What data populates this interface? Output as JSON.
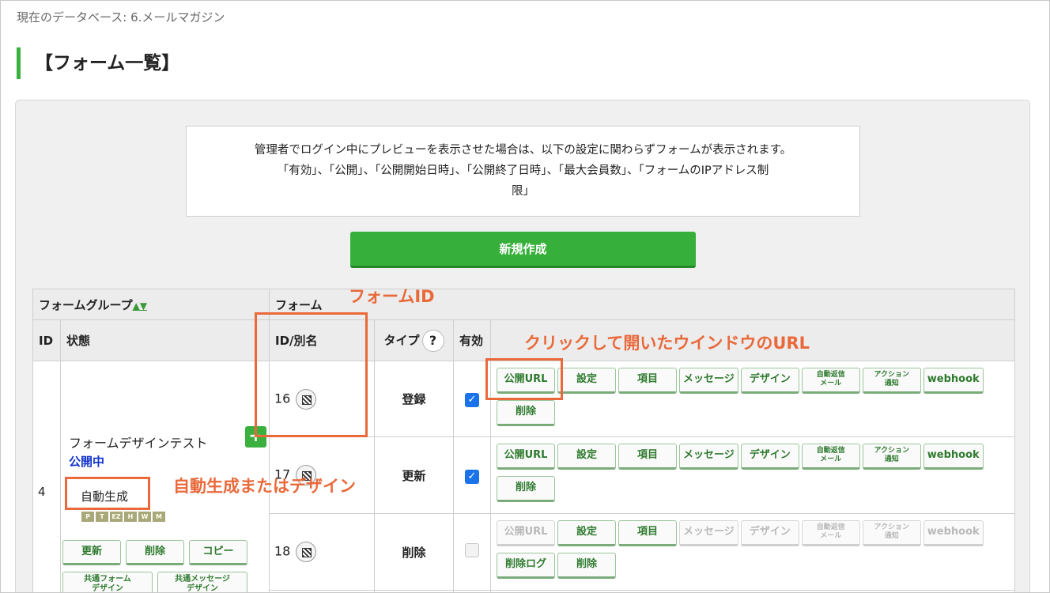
{
  "breadcrumb": "現在のデータベース: 6.メールマガジン",
  "page_title": "【フォーム一覧】",
  "notice": {
    "line1": "管理者でログイン中にプレビューを表示させた場合は、以下の設定に関わらずフォームが表示されます。",
    "line2": "「有効」、「公開」、「公開開始日時」、「公開終了日時」、「最大会員数」、「フォームのIPアドレス制",
    "line3": "限」"
  },
  "create_button": "新規作成",
  "table": {
    "group_header": "フォームグループ",
    "group_sort": "▲▼",
    "form_header": "フォーム",
    "col_id": "ID",
    "col_state": "状態",
    "col_form_id": "ID/別名",
    "col_type": "タイプ",
    "col_type_help": "?",
    "col_valid": "有効",
    "group": {
      "id": "4",
      "name": "フォームデザインテスト",
      "plus": "+",
      "state": "公開中",
      "auto": "自動生成",
      "mini_icons": [
        "P",
        "T",
        "EZ",
        "H",
        "W",
        "M"
      ],
      "buttons": {
        "update": "更新",
        "delete": "削除",
        "copy": "コピー",
        "common_form": "共通フォーム\nデザイン",
        "common_msg": "共通メッセージ\nデザイン"
      }
    },
    "rows": [
      {
        "id": "16",
        "type": "登録",
        "valid": true,
        "disabled": false,
        "buttons": [
          "公開URL",
          "設定",
          "項目",
          "メッセージ",
          "デザイン",
          "自動返信\nメール",
          "アクション\n通知",
          "webhook"
        ],
        "extra": [
          "削除"
        ]
      },
      {
        "id": "17",
        "type": "更新",
        "valid": true,
        "disabled": false,
        "buttons": [
          "公開URL",
          "設定",
          "項目",
          "メッセージ",
          "デザイン",
          "自動返信\nメール",
          "アクション\n通知",
          "webhook"
        ],
        "extra": [
          "削除"
        ]
      },
      {
        "id": "18",
        "type": "削除",
        "valid": false,
        "disabled": true,
        "buttons": [
          "公開URL",
          "設定",
          "項目",
          "メッセージ",
          "デザイン",
          "自動返信\nメール",
          "アクション\n通知",
          "webhook"
        ],
        "extra": [
          "削除ログ",
          "削除"
        ]
      }
    ]
  },
  "annotations": {
    "form_id": "フォームID",
    "public_url": "クリックして開いたウインドウのURL",
    "auto_design": "自動生成またはデザイン"
  },
  "colors": {
    "accent_green": "#36b03a",
    "annotation": "#e9693a",
    "state_blue": "#1133cc",
    "check_blue": "#1a73e8"
  }
}
